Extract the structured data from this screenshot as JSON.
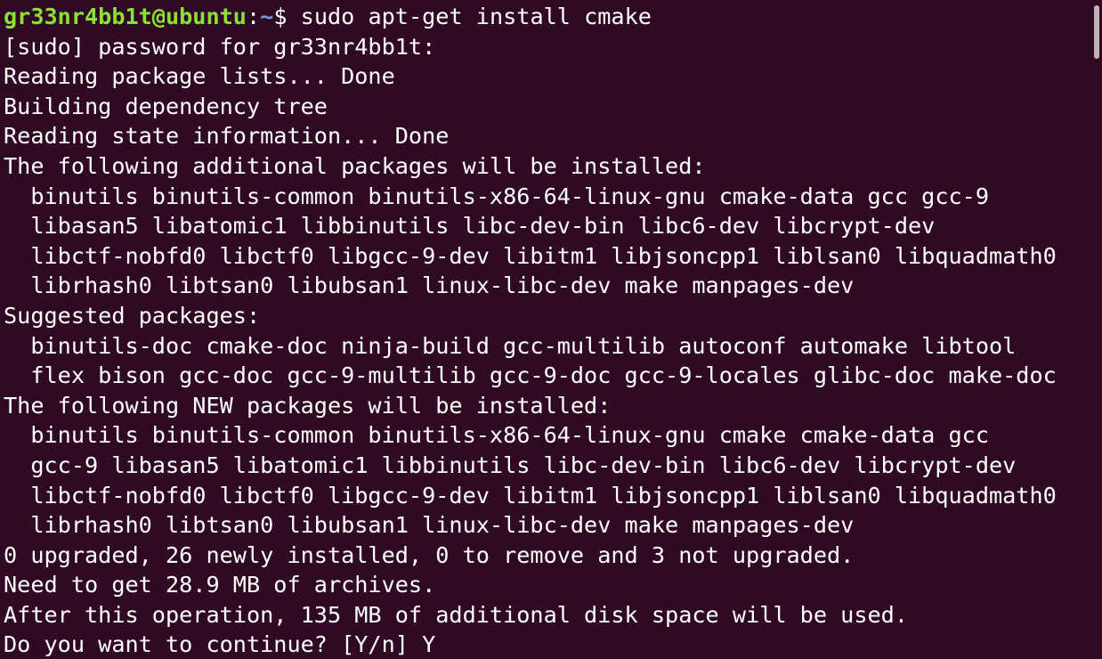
{
  "prompt": {
    "user_host": "gr33nr4bb1t@ubuntu",
    "colon": ":",
    "path": "~",
    "dollar": "$ ",
    "command": "sudo apt-get install cmake"
  },
  "output_lines": [
    "[sudo] password for gr33nr4bb1t:",
    "Reading package lists... Done",
    "Building dependency tree",
    "Reading state information... Done",
    "The following additional packages will be installed:",
    "  binutils binutils-common binutils-x86-64-linux-gnu cmake-data gcc gcc-9",
    "  libasan5 libatomic1 libbinutils libc-dev-bin libc6-dev libcrypt-dev",
    "  libctf-nobfd0 libctf0 libgcc-9-dev libitm1 libjsoncpp1 liblsan0 libquadmath0",
    "  librhash0 libtsan0 libubsan1 linux-libc-dev make manpages-dev",
    "Suggested packages:",
    "  binutils-doc cmake-doc ninja-build gcc-multilib autoconf automake libtool",
    "  flex bison gcc-doc gcc-9-multilib gcc-9-doc gcc-9-locales glibc-doc make-doc",
    "The following NEW packages will be installed:",
    "  binutils binutils-common binutils-x86-64-linux-gnu cmake cmake-data gcc",
    "  gcc-9 libasan5 libatomic1 libbinutils libc-dev-bin libc6-dev libcrypt-dev",
    "  libctf-nobfd0 libctf0 libgcc-9-dev libitm1 libjsoncpp1 liblsan0 libquadmath0",
    "  librhash0 libtsan0 libubsan1 linux-libc-dev make manpages-dev",
    "0 upgraded, 26 newly installed, 0 to remove and 3 not upgraded.",
    "Need to get 28.9 MB of archives.",
    "After this operation, 135 MB of additional disk space will be used.",
    "Do you want to continue? [Y/n] Y"
  ],
  "colors": {
    "background": "#300A24",
    "text": "#FFFFFF",
    "prompt_user": "#8AE234",
    "prompt_path": "#729FCF",
    "scrollbar_thumb": "#BFB3BB"
  }
}
